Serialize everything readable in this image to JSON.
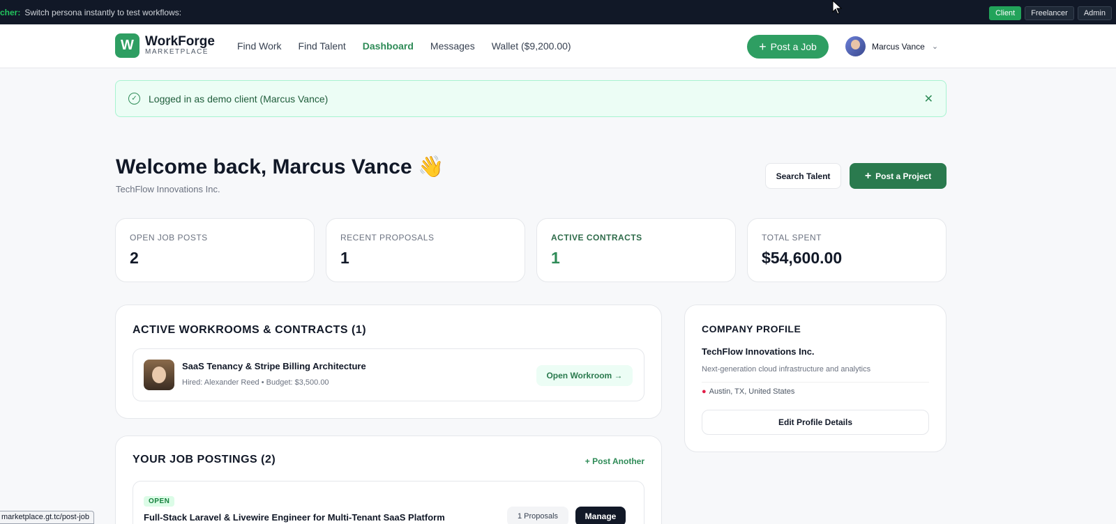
{
  "persona_bar": {
    "label": "cher:",
    "text": "Switch persona instantly to test workflows:",
    "options": [
      "Client",
      "Freelancer",
      "Admin"
    ]
  },
  "header": {
    "logo_letter": "W",
    "logo_name": "WorkForge",
    "logo_sub": "MARKETPLACE",
    "nav": [
      "Find Work",
      "Find Talent",
      "Dashboard",
      "Messages",
      "Wallet ($9,200.00)"
    ],
    "post_job_label": "Post a Job",
    "user_name": "Marcus Vance"
  },
  "alert": {
    "text": "Logged in as demo client (Marcus Vance)"
  },
  "welcome": {
    "title": "Welcome back, Marcus Vance 👋",
    "subtitle": "TechFlow Innovations Inc.",
    "search_talent": "Search Talent",
    "post_project": "Post a Project"
  },
  "stats": [
    {
      "label": "OPEN JOB POSTS",
      "value": "2"
    },
    {
      "label": "RECENT PROPOSALS",
      "value": "1"
    },
    {
      "label": "ACTIVE CONTRACTS",
      "value": "1"
    },
    {
      "label": "TOTAL SPENT",
      "value": "$54,600.00"
    }
  ],
  "workrooms": {
    "title": "ACTIVE WORKROOMS & CONTRACTS (1)",
    "items": [
      {
        "title": "SaaS Tenancy & Stripe Billing Architecture",
        "meta": "Hired: Alexander Reed • Budget: $3,500.00",
        "action": "Open Workroom →"
      }
    ]
  },
  "jobs": {
    "title": "YOUR JOB POSTINGS (2)",
    "post_another": "+ Post Another",
    "items": [
      {
        "status": "OPEN",
        "title": "Full-Stack Laravel & Livewire Engineer for Multi-Tenant SaaS Platform",
        "proposals": "1 Proposals",
        "manage": "Manage"
      }
    ]
  },
  "company": {
    "title": "COMPANY PROFILE",
    "name": "TechFlow Innovations Inc.",
    "description": "Next-generation cloud infrastructure and analytics",
    "location": "Austin, TX, United States",
    "edit_label": "Edit Profile Details"
  },
  "status_url": "marketplace.gt.tc/post-job",
  "colors": {
    "brand": "#2e9e62",
    "dark_bar": "#111827",
    "alert_bg": "#ecfdf5"
  }
}
